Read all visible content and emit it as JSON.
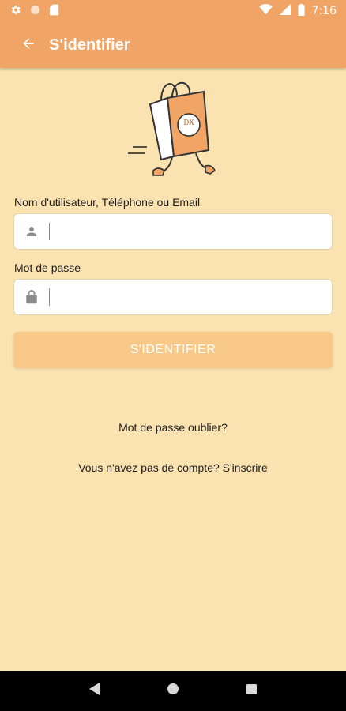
{
  "status_bar": {
    "time": "7:16",
    "left_icons": [
      "gear-icon",
      "circle-icon",
      "sd-card-icon"
    ],
    "right_icons": [
      "wifi-icon",
      "signal-icon",
      "battery-icon"
    ]
  },
  "app_bar": {
    "title": "S'identifier",
    "back_icon": "arrow-left-icon"
  },
  "illustration": {
    "bag_text": "DX",
    "icon": "shopping-bag-illustration"
  },
  "form": {
    "username_label": "Nom d'utilisateur, Téléphone ou Email",
    "username_value": "",
    "username_icon": "person-icon",
    "password_label": "Mot de passe",
    "password_value": "",
    "password_icon": "lock-icon",
    "submit_label": "S'IDENTIFIER"
  },
  "links": {
    "forgot_password": "Mot de passe oublier?",
    "signup": "Vous n'avez pas de compte? S'inscrire"
  },
  "colors": {
    "primary": "#F0A466",
    "background": "#FBE2B1",
    "button_disabled": "#F7C888"
  },
  "nav_bar": {
    "buttons": [
      "back-triangle-icon",
      "home-circle-icon",
      "recents-square-icon"
    ]
  }
}
